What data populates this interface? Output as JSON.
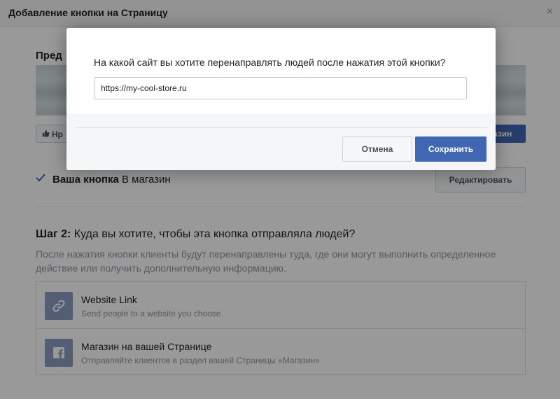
{
  "dialog": {
    "title": "Добавление кнопки на Страницу",
    "close_label": "×",
    "preview_label": "Пред",
    "like_label": "Нр",
    "cta_preview_label": "азин"
  },
  "current_button": {
    "label_bold": "Ваша кнопка",
    "value": "В магазин",
    "edit_label": "Редактировать"
  },
  "step2": {
    "label_bold": "Шаг 2:",
    "title": "Куда вы хотите, чтобы эта кнопка отправляла людей?",
    "description": "После нажатия кнопки клиенты будут перенаправлены туда, где они могут выполнить определенное действие или получить дополнительную информацию.",
    "options": [
      {
        "icon": "link-icon",
        "title": "Website Link",
        "subtitle": "Send people to a website you choose."
      },
      {
        "icon": "facebook-icon",
        "title": "Магазин на вашей Странице",
        "subtitle": "Отправляйте клиентов в раздел вашей Страницы «Магазин»"
      }
    ]
  },
  "modal": {
    "question": "На какой сайт вы хотите перенаправлять людей после нажатия этой кнопки?",
    "url_value": "https://my-cool-store.ru",
    "cancel_label": "Отмена",
    "save_label": "Сохранить"
  },
  "colors": {
    "accent": "#4267b2",
    "option_icon_bg": "#8b9dc3",
    "overlay": "#000000"
  }
}
